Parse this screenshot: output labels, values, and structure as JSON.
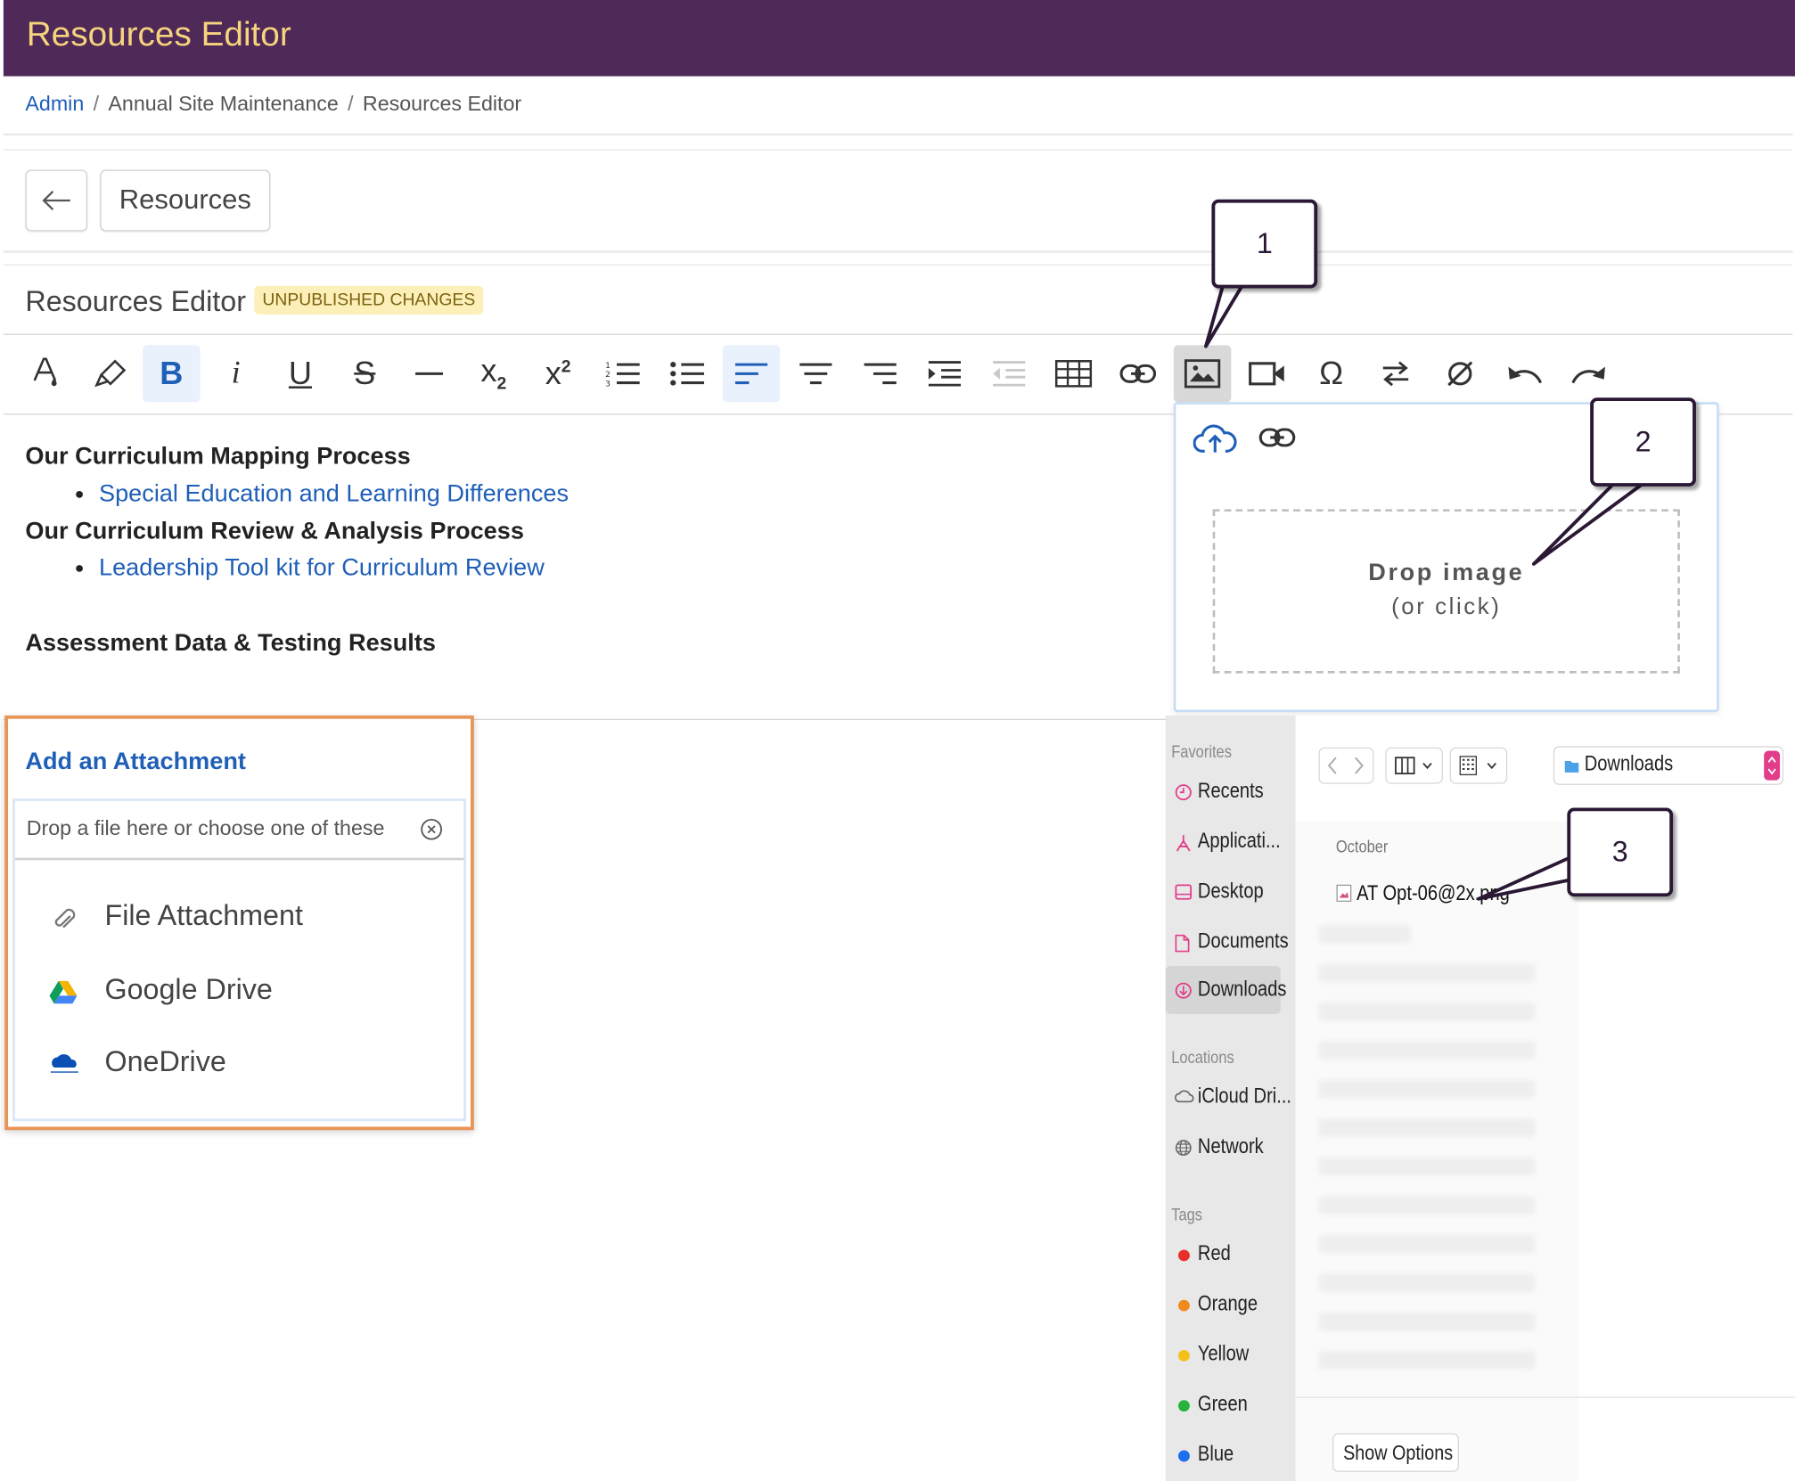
{
  "app": {
    "title": "Resources Editor"
  },
  "breadcrumb": {
    "admin": "Admin",
    "separator": "/",
    "maintenance": "Annual Site Maintenance",
    "current": "Resources Editor"
  },
  "nav": {
    "back_icon": "arrow-left-icon",
    "resources_label": "Resources"
  },
  "editor": {
    "heading": "Resources Editor",
    "badge": "UNPUBLISHED CHANGES",
    "toolbar": {
      "font_color_icon": "font-color-icon",
      "highlight_icon": "highlighter-icon",
      "bold": "B",
      "italic": "i",
      "underline": "U",
      "strike": "S",
      "subscript": "x",
      "subscript_suffix": "2",
      "superscript": "x",
      "superscript_suffix": "2",
      "omega": "Ω"
    },
    "content": {
      "heading_1": "Our Curriculum Mapping Process",
      "link_1": "Special Education and Learning Differences",
      "heading_2": "Our Curriculum Review & Analysis Process",
      "link_2": "Leadership Tool kit for Curriculum Review",
      "heading_3": "Assessment Data & Testing Results"
    }
  },
  "image_popup": {
    "upload_icon": "cloud-upload-icon",
    "link_icon": "link-icon",
    "drop_title": "Drop image",
    "drop_subtitle": "(or click)"
  },
  "attachment": {
    "header": "Add an Attachment",
    "placeholder": "Drop a file here or choose one of these",
    "options": [
      {
        "label": "File Attachment",
        "icon": "paperclip-icon"
      },
      {
        "label": "Google Drive",
        "icon": "google-drive-icon"
      },
      {
        "label": "OneDrive",
        "icon": "onedrive-icon"
      }
    ]
  },
  "finder": {
    "favorites_label": "Favorites",
    "favorites": [
      "Recents",
      "Applicati...",
      "Desktop",
      "Documents",
      "Downloads"
    ],
    "locations_label": "Locations",
    "locations": [
      "iCloud Dri...",
      "Network"
    ],
    "tags_label": "Tags",
    "tags": [
      {
        "name": "Red",
        "color": "#e8302a"
      },
      {
        "name": "Orange",
        "color": "#f08a1d"
      },
      {
        "name": "Yellow",
        "color": "#f3c21a"
      },
      {
        "name": "Green",
        "color": "#27b33b"
      },
      {
        "name": "Blue",
        "color": "#1e6ef0"
      }
    ],
    "location_dropdown": "Downloads",
    "group_label": "October",
    "file_name": "AT Opt-06@2x.png",
    "show_options": "Show Options"
  },
  "callouts": [
    "1",
    "2",
    "3"
  ],
  "colors": {
    "header_bg": "#4f2957",
    "header_title": "#f6d47e",
    "link": "#1f5fb8",
    "attachment_border": "#e8955a",
    "badge_bg": "#fcf0b8"
  }
}
